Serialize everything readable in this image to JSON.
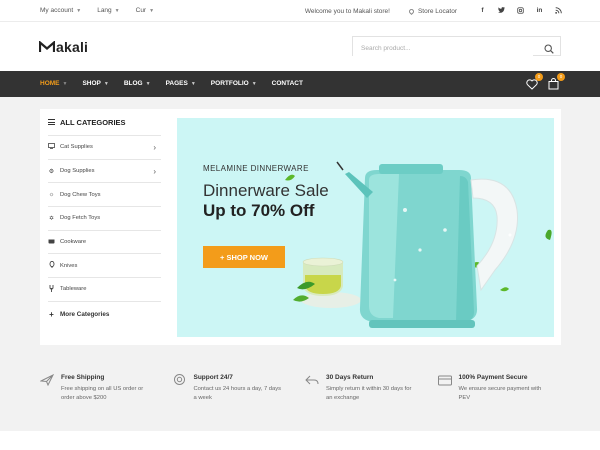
{
  "topbar": {
    "account": "My account",
    "lang": "Lang",
    "currency": "Cur",
    "welcome": "Welcome you to Makali store!",
    "store_locator": "Store Locator",
    "social": [
      "f",
      "t",
      "ig",
      "in",
      "rss"
    ]
  },
  "header": {
    "logo_text": "akali",
    "search_placeholder": "Search product..."
  },
  "nav": {
    "items": [
      {
        "label": "HOME",
        "has_dropdown": true,
        "active": true
      },
      {
        "label": "SHOP",
        "has_dropdown": true
      },
      {
        "label": "BLOG",
        "has_dropdown": true
      },
      {
        "label": "PAGES",
        "has_dropdown": true
      },
      {
        "label": "PORTFOLIO",
        "has_dropdown": true
      },
      {
        "label": "CONTACT",
        "has_dropdown": false
      }
    ],
    "wishlist_count": "0",
    "cart_count": "0",
    "accent": "#f39c1a",
    "bar_color": "#333333"
  },
  "categories": {
    "title": "ALL CATEGORIES",
    "items": [
      {
        "label": "Cat Supplies",
        "icon": "monitor-icon",
        "has_sub": true
      },
      {
        "label": "Dog Supplies",
        "icon": "gear-icon",
        "has_sub": true
      },
      {
        "label": "Dog Chew Toys",
        "icon": "sun-icon",
        "has_sub": false
      },
      {
        "label": "Dog Fetch Toys",
        "icon": "pinwheel-icon",
        "has_sub": false
      },
      {
        "label": "Cookware",
        "icon": "pot-icon",
        "has_sub": false
      },
      {
        "label": "Knives",
        "icon": "knife-icon",
        "has_sub": false
      },
      {
        "label": "Tableware",
        "icon": "fork-icon",
        "has_sub": false
      }
    ],
    "more": "More Categories"
  },
  "banner": {
    "eyebrow": "MELAMINE DINNERWARE",
    "title": "Dinnerware Sale",
    "subtitle": "Up to 70% Off",
    "button": "+ SHOP NOW",
    "bg": "#ccf6f5"
  },
  "features": [
    {
      "icon": "plane-icon",
      "title": "Free Shipping",
      "text": "Free shipping on all US order or order above $200"
    },
    {
      "icon": "lifebuoy-icon",
      "title": "Support 24/7",
      "text": "Contact us 24 hours a day, 7 days a week"
    },
    {
      "icon": "return-icon",
      "title": "30 Days Return",
      "text": "Simply return it within 30 days for an exchange"
    },
    {
      "icon": "card-icon",
      "title": "100% Payment Secure",
      "text": "We ensure secure payment with PEV"
    }
  ]
}
